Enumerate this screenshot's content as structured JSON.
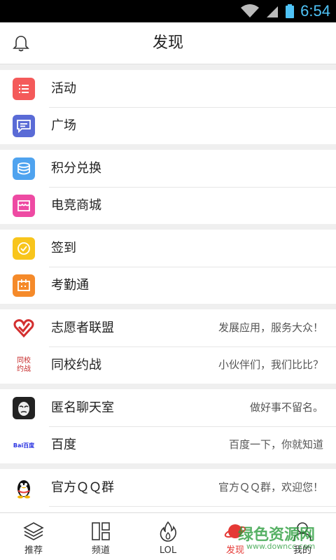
{
  "status_bar": {
    "time": "6:54"
  },
  "header": {
    "title": "发现"
  },
  "groups": [
    {
      "items": [
        {
          "label": "活动",
          "color": "#f45a5a"
        },
        {
          "label": "广场",
          "color": "#5a6bd6"
        }
      ]
    },
    {
      "items": [
        {
          "label": "积分兑换",
          "color": "#4fa3ef"
        },
        {
          "label": "电竞商城",
          "color": "#ee4aa3"
        }
      ]
    },
    {
      "items": [
        {
          "label": "签到",
          "color": "#f8c51c"
        },
        {
          "label": "考勤通",
          "color": "#f58a2a"
        }
      ]
    },
    {
      "items": [
        {
          "label": "志愿者联盟",
          "desc": "发展应用，服务大众！"
        },
        {
          "label": "同校约战",
          "desc": "小伙伴们，我们比比？",
          "icon_text": [
            "同校",
            "约战"
          ]
        }
      ]
    },
    {
      "items": [
        {
          "label": "匿名聊天室",
          "desc": "做好事不留名。"
        },
        {
          "label": "百度",
          "desc": "百度一下，你就知道",
          "icon_text": "Bai百度"
        }
      ]
    },
    {
      "items": [
        {
          "label": "官方ＱＱ群",
          "desc": "官方ＱＱ群，欢迎您！"
        }
      ]
    }
  ],
  "tabs": [
    {
      "label": "推荐",
      "icon": "layers-icon"
    },
    {
      "label": "频道",
      "icon": "grid-icon"
    },
    {
      "label": "LOL",
      "icon": "flame-icon"
    },
    {
      "label": "发现",
      "icon": "planet-icon",
      "active": true
    },
    {
      "label": "我的",
      "icon": "user-icon"
    }
  ],
  "watermark": {
    "text": "绿色资源网",
    "url": "www.downcc.com"
  },
  "colors": {
    "active_tab": "#e53935",
    "time": "#4fc3f7"
  }
}
